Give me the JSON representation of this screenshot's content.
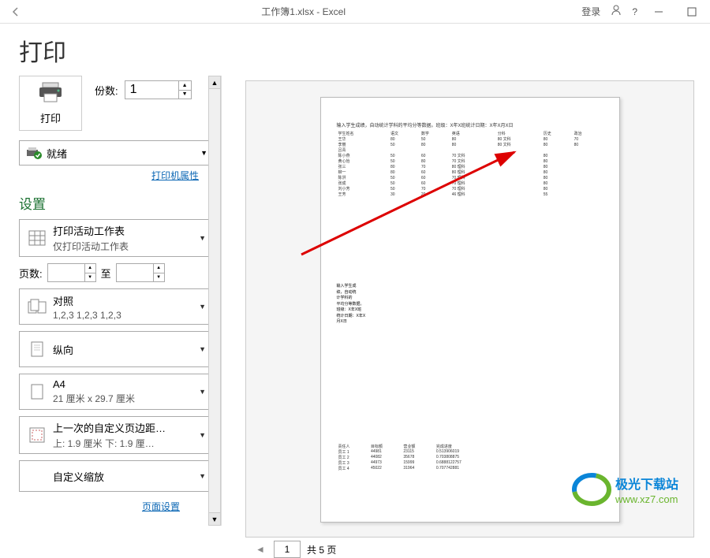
{
  "titlebar": {
    "filename": "工作簿1.xlsx  -  Excel",
    "login": "登录",
    "help": "?"
  },
  "page": {
    "title": "打印"
  },
  "print_button": {
    "label": "打印"
  },
  "copies": {
    "label": "份数:",
    "value": "1"
  },
  "printer": {
    "status": "就绪",
    "properties_link": "打印机属性"
  },
  "settings": {
    "heading": "设置",
    "scope": {
      "line1": "打印活动工作表",
      "line2": "仅打印活动工作表"
    },
    "pages": {
      "label": "页数:",
      "to": "至"
    },
    "collate": {
      "line1": "对照",
      "line2": "1,2,3    1,2,3    1,2,3"
    },
    "orientation": {
      "line1": "纵向"
    },
    "paper": {
      "line1": "A4",
      "line2": "21 厘米 x 29.7 厘米"
    },
    "margins": {
      "line1": "上一次的自定义页边距…",
      "line2": "上: 1.9 厘米 下: 1.9 厘…"
    },
    "scaling": {
      "line1": "自定义缩放"
    },
    "page_setup_link": "页面设置"
  },
  "preview": {
    "heading": "输入学生成绩，自动统计学科的平均分等数据。班级：X年X班统计日期：X年X月X日",
    "headers": [
      "学生姓名",
      "语文",
      "数学",
      "英语",
      "分科",
      "历史",
      "政治"
    ],
    "rows": [
      [
        "王华",
        "80",
        "50",
        "80",
        "80 文科",
        "80",
        "70"
      ],
      [
        "李丽",
        "50",
        "80",
        "80",
        "80 文科",
        "80",
        "80"
      ],
      [
        "吕青",
        "",
        "",
        "",
        "",
        "",
        ""
      ],
      [
        "陈小燕",
        "50",
        "60",
        "70 文科",
        "",
        "80",
        ""
      ],
      [
        "黄心怡",
        "50",
        "80",
        "70 文科",
        "",
        "80",
        ""
      ],
      [
        "张三",
        "80",
        "70",
        "80 理科",
        "",
        "80",
        ""
      ],
      [
        "柳一",
        "80",
        "60",
        "80 理科",
        "",
        "80",
        ""
      ],
      [
        "陈洪",
        "50",
        "60",
        "70 理科",
        "",
        "80",
        ""
      ],
      [
        "张成",
        "50",
        "60",
        "70 理科",
        "",
        "80",
        ""
      ],
      [
        "刘小芳",
        "50",
        "70",
        "70 理科",
        "",
        "80",
        ""
      ],
      [
        "王芳",
        "30",
        "20",
        "46 理科",
        "",
        "55",
        ""
      ]
    ],
    "block2": [
      "输入学生成",
      "绩，自动统",
      "计学科的",
      "平均分等数据。",
      "班级：X年X班",
      "统计日期：X年X",
      "月X日"
    ],
    "block3_head": [
      "责任人",
      "目标额",
      "营业额",
      "完成进度"
    ],
    "block3_rows": [
      [
        "员工 1",
        "44981",
        "23115",
        "0.513906019"
      ],
      [
        "员工 2",
        "44082",
        "35678",
        "0.703808875"
      ],
      [
        "员工 3",
        "44973",
        "15999",
        "0.6888122757"
      ],
      [
        "员工 4",
        "45022",
        "31964",
        "0.707742881"
      ]
    ]
  },
  "pager": {
    "current": "1",
    "total_label": "共 5 页"
  },
  "watermark": {
    "brand": "极光下载站",
    "url": "www.xz7.com"
  }
}
